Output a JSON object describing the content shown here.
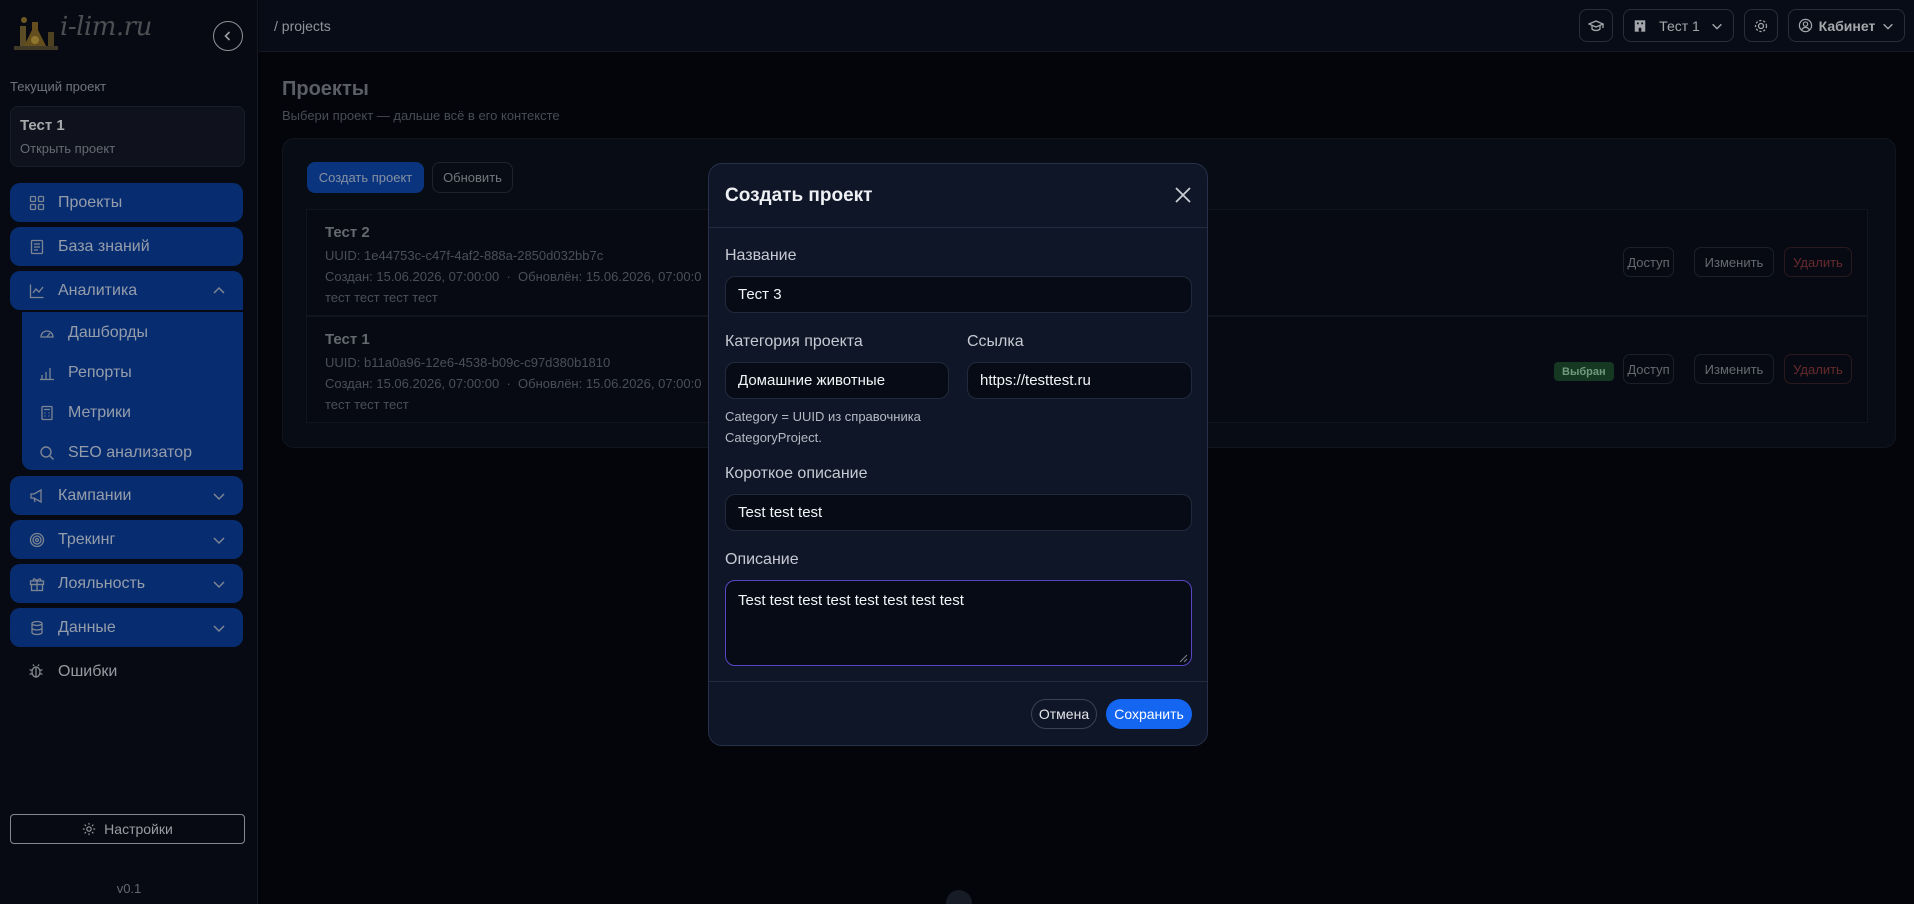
{
  "brand": {
    "logo_text": "i-lim.ru"
  },
  "sidebar": {
    "current_project_label": "Текущий проект",
    "current_project": {
      "title": "Тест 1",
      "subtitle": "Открыть проект"
    },
    "items": [
      {
        "label": "Проекты",
        "icon": "grid-icon"
      },
      {
        "label": "База знаний",
        "icon": "book-icon"
      },
      {
        "label": "Аналитика",
        "icon": "chart-line-icon",
        "expanded": true
      }
    ],
    "analytics_sub": [
      {
        "label": "Дашборды",
        "icon": "gauge-icon"
      },
      {
        "label": "Репорты",
        "icon": "bar-chart-icon"
      },
      {
        "label": "Метрики",
        "icon": "calculator-icon"
      },
      {
        "label": "SEO анализатор",
        "icon": "search-icon"
      }
    ],
    "groups": [
      {
        "label": "Кампании",
        "icon": "megaphone-icon"
      },
      {
        "label": "Трекинг",
        "icon": "target-icon"
      },
      {
        "label": "Лояльность",
        "icon": "gift-icon"
      },
      {
        "label": "Данные",
        "icon": "database-icon"
      }
    ],
    "errors_label": "Ошибки",
    "settings_label": "Настройки",
    "version": "v0.1"
  },
  "topbar": {
    "breadcrumb": "/ projects",
    "project_select": "Тест 1",
    "cabinet_label": "Кабинет"
  },
  "main": {
    "title": "Проекты",
    "subtitle": "Выбери проект — дальше всё в его контексте",
    "create_button": "Создать проект",
    "refresh_button": "Обновить",
    "projects": [
      {
        "name": "Тест 2",
        "uuid": "UUID: 1e44753c-c47f-4af2-888a-2850d032bb7c",
        "dates": "Создан: 15.06.2026, 07:00:00  ·  Обновлён: 15.06.2026, 07:00:0",
        "description": "тест тест тест тест",
        "selected": false
      },
      {
        "name": "Тест 1",
        "uuid": "UUID: b11a0a96-12e6-4538-b09c-c97d380b1810",
        "dates": "Создан: 15.06.2026, 07:00:00  ·  Обновлён: 15.06.2026, 07:00:0",
        "description": "тест тест тест",
        "selected": true
      }
    ],
    "row_actions": {
      "access": "Доступ",
      "edit": "Изменить",
      "delete": "Удалить"
    },
    "selected_badge": "Выбран"
  },
  "modal": {
    "title": "Создать проект",
    "name_label": "Название",
    "name_value": "Тест 3",
    "category_label": "Категория проекта",
    "category_value": "Домашние животные",
    "link_label": "Ссылка",
    "link_value": "https://testtest.ru",
    "category_hint": "Category = UUID из справочника CategoryProject.",
    "short_desc_label": "Короткое описание",
    "short_desc_value": "Test test test",
    "desc_label": "Описание",
    "desc_value": "Test test test test test test test test",
    "cancel_button": "Отмена",
    "save_button": "Сохранить"
  },
  "colors": {
    "accent": "#1466f0",
    "nav_active": "#0a3f9c",
    "selected_badge": "#1c4e30",
    "delete_text": "#8e3b3f"
  }
}
